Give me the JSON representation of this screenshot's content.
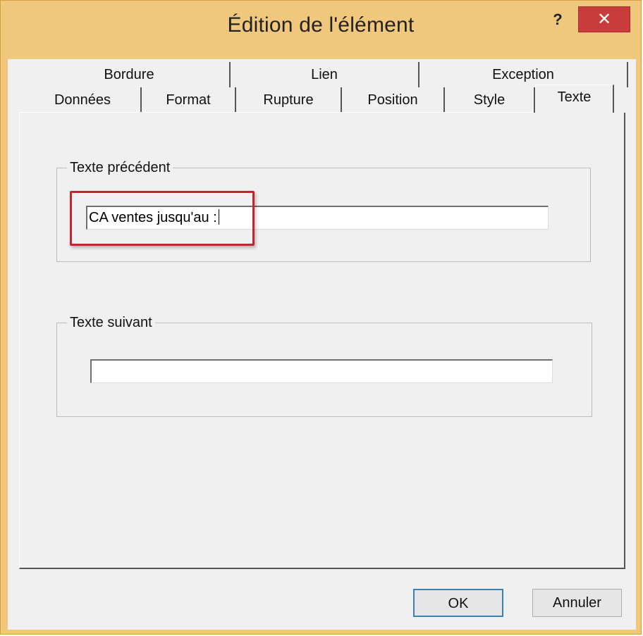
{
  "window": {
    "title": "Édition de l'élément",
    "help_label": "?",
    "close_label": "✕"
  },
  "tabs": {
    "back_row": [
      "Bordure",
      "Lien",
      "Exception"
    ],
    "front_row": [
      "Données",
      "Format",
      "Rupture",
      "Position",
      "Style",
      "Texte"
    ],
    "active": "Texte"
  },
  "groups": {
    "preceding": {
      "label": "Texte précédent",
      "value": "CA ventes jusqu'au :"
    },
    "following": {
      "label": "Texte suivant",
      "value": ""
    }
  },
  "buttons": {
    "ok": "OK",
    "cancel": "Annuler"
  },
  "colors": {
    "title_bar": "#f0c87d",
    "close_button": "#c83c3c",
    "highlight": "#c0262d",
    "dialog_bg": "#f0f0f0"
  }
}
